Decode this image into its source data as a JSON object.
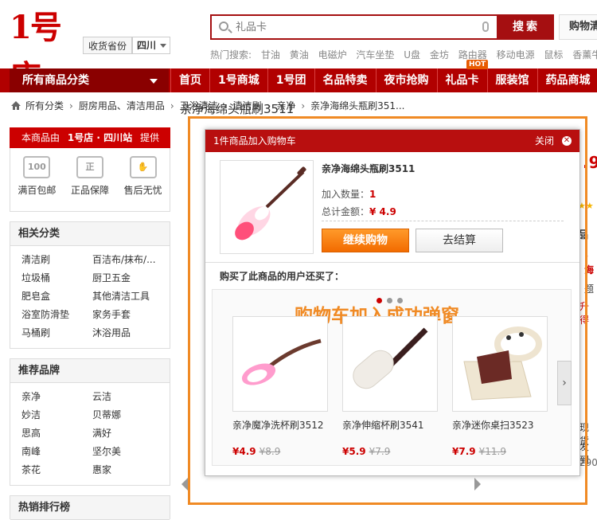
{
  "header": {
    "logo_text": "1号店",
    "region_label": "收货省份",
    "region_value": "四川",
    "search_placeholder": "礼品卡",
    "search_button": "搜索",
    "cart_button": "购物清",
    "hot_label": "热门搜索:",
    "hot_terms": [
      "甘油",
      "黄油",
      "电磁炉",
      "汽车坐垫",
      "U盘",
      "金坊",
      "路由器",
      "移动电源",
      "鼠标",
      "香薰牛"
    ]
  },
  "nav": {
    "all_categories": "所有商品分类",
    "items": [
      "首页",
      "1号商城",
      "1号团",
      "名品特卖",
      "夜市抢购",
      "礼品卡",
      "服装馆",
      "药品商城"
    ],
    "hot_badge": "HOT"
  },
  "breadcrumb": [
    "所有分类",
    "厨房用品、清洁用品",
    "卫浴清洁",
    "清洁刷",
    "亲净",
    "亲净海绵头瓶刷351..."
  ],
  "sidebar": {
    "shop_prefix": "本商品由",
    "shop_name": "1号店 · 四川站",
    "shop_suffix": "提供",
    "guarantees": [
      {
        "label": "满百包邮",
        "icon": "truck-icon",
        "icon_text": "100"
      },
      {
        "label": "正品保障",
        "icon": "shield-icon",
        "icon_text": "正"
      },
      {
        "label": "售后无忧",
        "icon": "handshake-icon",
        "icon_text": "✋"
      }
    ],
    "related_title": "相关分类",
    "related": [
      "清洁刷",
      "百洁布/抹布/...",
      "垃圾桶",
      "厨卫五金",
      "肥皂盒",
      "其他清洁工具",
      "浴室防滑垫",
      "家务手套",
      "马桶刷",
      "沐浴用品"
    ],
    "brands_title": "推荐品牌",
    "brands": [
      "亲净",
      "云洁",
      "妙洁",
      "贝蒂娜",
      "思高",
      "满好",
      "南峰",
      "坚尔美",
      "茶花",
      "惠家"
    ],
    "ranking_title": "热销排行榜"
  },
  "page": {
    "product_title": "亲净海绵头瓶刷3511",
    "right_peeks": [
      ".9",
      "品",
      "，",
      "海",
      "题",
      "升得",
      "现货",
      "发到",
      "290"
    ]
  },
  "popup": {
    "title": "1件商品加入购物车",
    "close_label": "关闭",
    "product_name": "亲净海绵头瓶刷3511",
    "qty_label": "加入数量：",
    "qty_value": "1",
    "total_label": "总计金额：",
    "total_value": "¥ 4.9",
    "continue_button": "继续购物",
    "checkout_button": "去结算",
    "also_bought_title": "购买了此商品的用户还买了：",
    "annotation": "购物车加入成功弹窗",
    "recommendations": [
      {
        "name": "亲净魔净洗杯刷3512",
        "price": "¥4.9",
        "old_price": "¥8.9"
      },
      {
        "name": "亲净伸缩杯刷3541",
        "price": "¥5.9",
        "old_price": "¥7.9"
      },
      {
        "name": "亲净迷你桌扫3523",
        "price": "¥7.9",
        "old_price": "¥11.9"
      }
    ]
  },
  "colors": {
    "brand_red": "#b10000",
    "accent_orange": "#f08a24",
    "price_red": "#cc0000"
  }
}
